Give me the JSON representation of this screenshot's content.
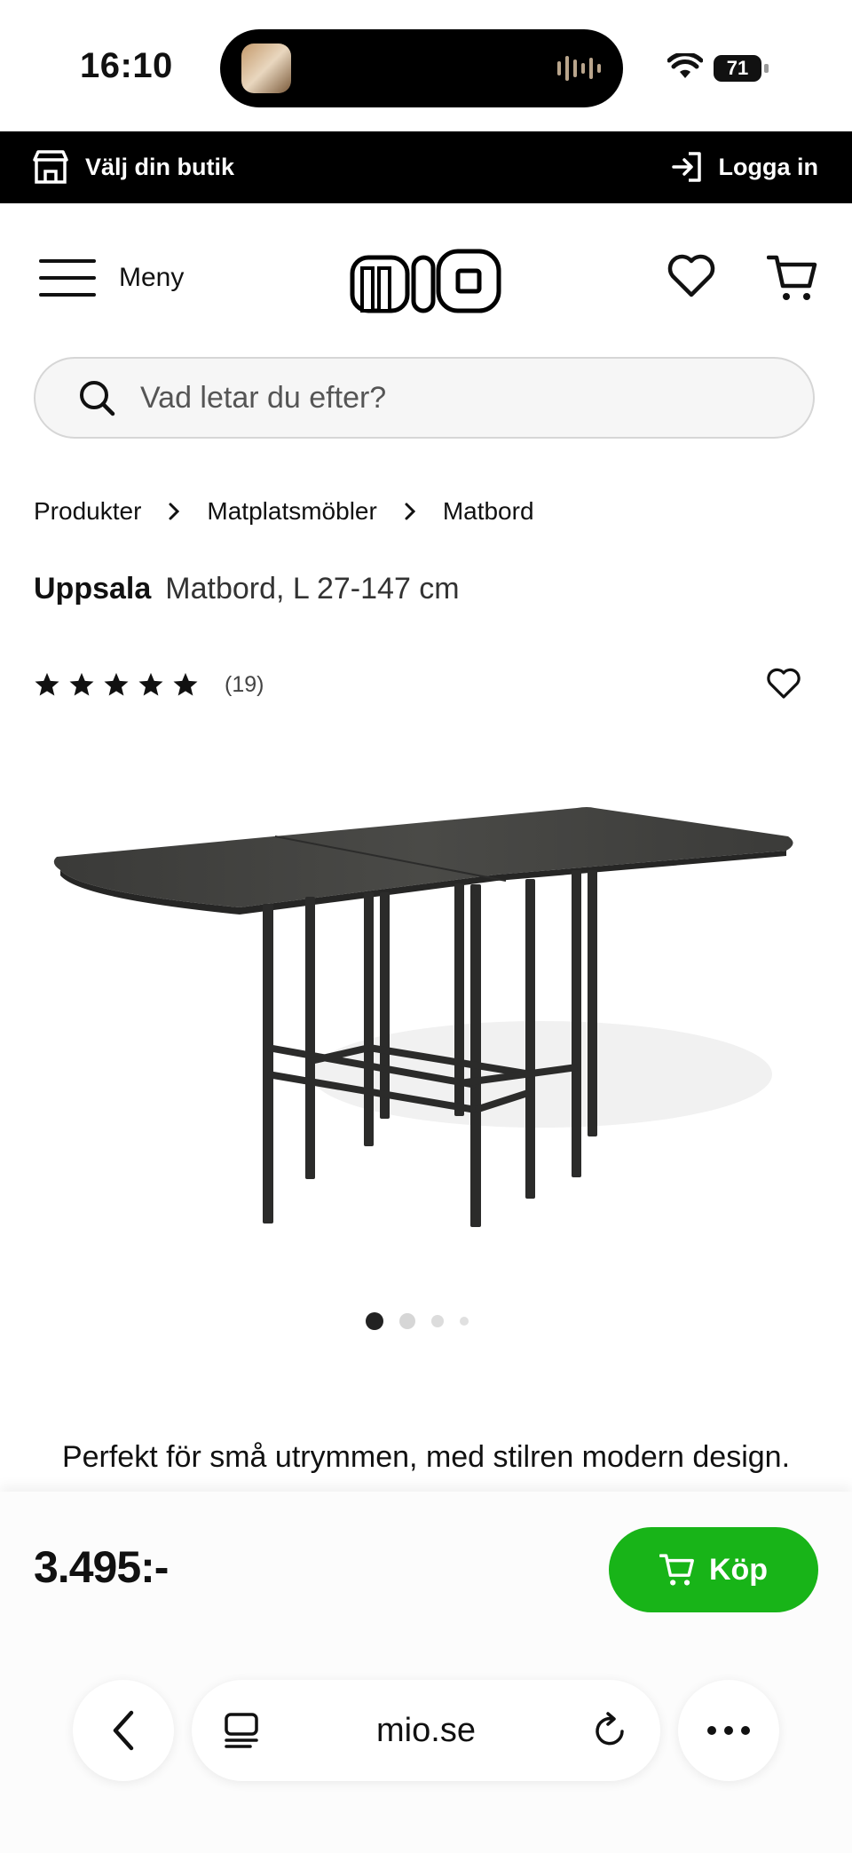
{
  "status_bar": {
    "time": "16:10",
    "battery": "71"
  },
  "topbar": {
    "store_label": "Välj din butik",
    "login_label": "Logga in"
  },
  "header": {
    "menu_label": "Meny",
    "logo_text": "mio"
  },
  "search": {
    "placeholder": "Vad letar du efter?"
  },
  "breadcrumb": [
    "Produkter",
    "Matplatsmöbler",
    "Matbord"
  ],
  "product": {
    "brand": "Uppsala",
    "name": "Matbord, L 27-147 cm",
    "rating_count": "(19)",
    "rating": 5,
    "image_count": 4,
    "active_image": 1,
    "tagline": "Perfekt för små utrymmen, med stilren modern design.",
    "price": "3.495:-",
    "buy_label": "Köp"
  },
  "browser": {
    "url": "mio.se"
  },
  "colors": {
    "buy_green": "#18b418",
    "topbar_black": "#000000"
  }
}
